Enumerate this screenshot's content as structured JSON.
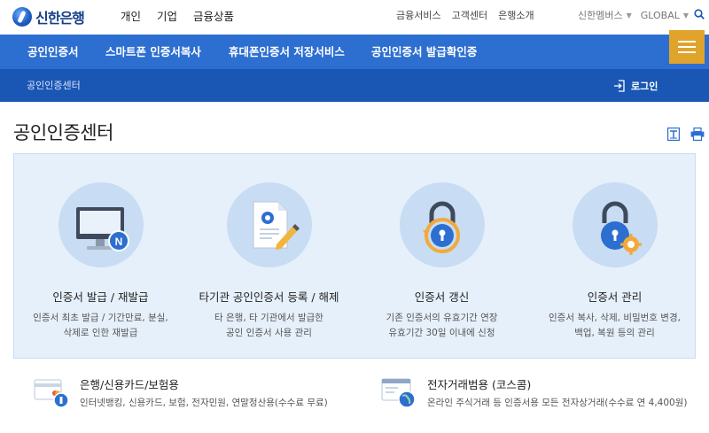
{
  "header": {
    "logo_text": "신한은행",
    "primary_nav": [
      "개인",
      "기업",
      "금융상품"
    ],
    "secondary_nav": [
      "금융서비스",
      "고객센터",
      "은행소개"
    ],
    "utility": [
      {
        "label": "신한멤버스"
      },
      {
        "label": "GLOBAL"
      }
    ]
  },
  "menu": [
    "공인인증서",
    "스마트폰 인증서복사",
    "휴대폰인증서 저장서비스",
    "공인인증서 발급확인증"
  ],
  "subbar": {
    "breadcrumb": "공인인증센터",
    "login_label": "로그인"
  },
  "page": {
    "title": "공인인증센터"
  },
  "cards": [
    {
      "icon": "monitor-icon",
      "title": "인증서 발급 / 재발급",
      "desc": [
        "인증서 최초 발급 / 기간만료, 분실,",
        "삭제로 인한 재발급"
      ]
    },
    {
      "icon": "document-pen-icon",
      "title": "타기관 공인인증서 등록 / 해제",
      "desc": [
        "타 은행, 타 기관에서 발급한",
        "공인 인증서 사용 관리"
      ]
    },
    {
      "icon": "lock-refresh-icon",
      "title": "인증서 갱신",
      "desc": [
        "기존 인증서의 유효기간 연장",
        "유효기간 30일 이내에 신청"
      ]
    },
    {
      "icon": "lock-gear-icon",
      "title": "인증서 관리",
      "desc": [
        "인증서 복사, 삭제, 비밀번호 변경,",
        "백업, 복원 등의 관리"
      ]
    }
  ],
  "bottom": [
    {
      "icon": "card-icon",
      "title": "은행/신용카드/보험용",
      "desc": "인터넷뱅킹, 신용카드, 보험, 전자민원, 연말정산용(수수료 무료)"
    },
    {
      "icon": "globe-window-icon",
      "title": "전자거래범용 (코스콤)",
      "desc": "온라인 주식거래 등 인증서용 모든 전자상거래(수수료 연 4,400원)"
    }
  ],
  "colors": {
    "menu_blue": "#2d6fd0",
    "sub_blue": "#1a56b3",
    "hamburger_orange": "#e0a32b",
    "panel_bg": "#e6f0fb",
    "circle_bg": "#c8dcf3"
  }
}
